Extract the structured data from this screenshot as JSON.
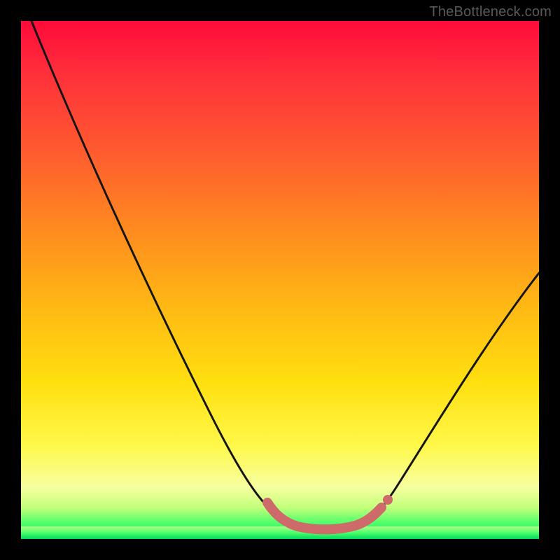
{
  "watermark": "TheBottleneck.com",
  "colors": {
    "curve_stroke": "#161616",
    "accent_dots": "#cf6a6a",
    "frame": "#000000"
  },
  "chart_data": {
    "type": "line",
    "title": "",
    "xlabel": "",
    "ylabel": "",
    "xlim": [
      0,
      100
    ],
    "ylim": [
      0,
      100
    ],
    "grid": false,
    "legend": false,
    "series": [
      {
        "name": "bottleneck-curve",
        "x": [
          0,
          10,
          20,
          30,
          40,
          48,
          52,
          58,
          64,
          68,
          75,
          85,
          95,
          100
        ],
        "y": [
          100,
          80,
          60,
          40,
          22,
          10,
          4,
          1,
          1,
          3,
          10,
          25,
          42,
          52
        ]
      }
    ],
    "accent_segment": {
      "name": "valley-highlight",
      "x": [
        48,
        52,
        56,
        60,
        64,
        67
      ],
      "y": [
        8,
        3,
        1,
        1,
        2,
        5
      ]
    }
  }
}
